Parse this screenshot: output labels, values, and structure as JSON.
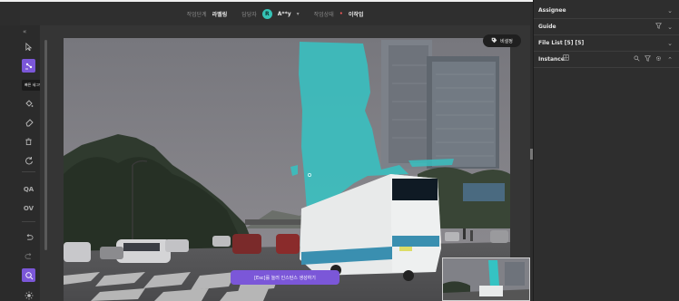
{
  "header": {
    "task_label": "작업단계",
    "task_value": "라벨링",
    "worker_label": "담당자",
    "worker_avatar": "R",
    "worker_name": "A**y",
    "status_label": "작업상태",
    "status_value": "이작업"
  },
  "toolbar": {
    "tooltip": "빠른 세그멘트",
    "qa_label": "QA",
    "ov_label": "OV"
  },
  "canvas": {
    "tag_button_label": "비설정",
    "hint_text": "[Esc]를 눌러 인스턴스 생성하기"
  },
  "right_panel": {
    "assignee_label": "Assignee",
    "guide_label": "Guide",
    "file_list_label": "File List [5] [5]",
    "instance_label": "Instance"
  },
  "colors": {
    "accent": "#7b57d8",
    "mask": "#35c3c3",
    "avatar": "#35c3b6",
    "status_dot": "#ff5b5b"
  },
  "icons": {
    "collapse": "double-chevron-left-icon",
    "select": "cursor-arrow-icon",
    "quick_segment": "magic-segment-icon",
    "fill": "paint-bucket-icon",
    "eraser": "eraser-icon",
    "delete": "trash-icon",
    "reset": "rotate-icon",
    "undo": "undo-icon",
    "redo": "redo-icon",
    "zoom": "zoom-icon",
    "brightness": "sun-icon"
  }
}
